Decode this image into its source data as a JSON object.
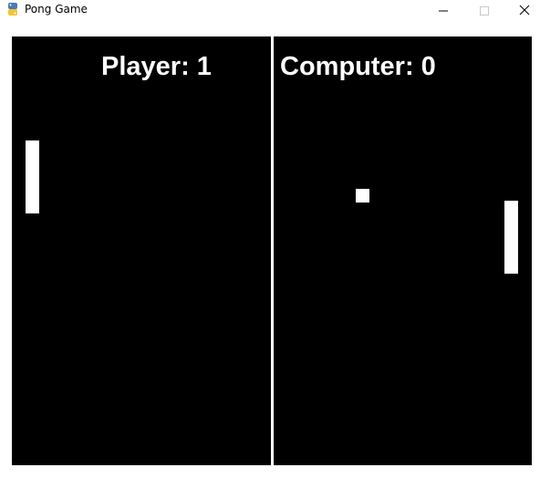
{
  "window": {
    "title": "Pong Game",
    "app_icon": "python-icon",
    "controls": {
      "minimize_icon": "minimize-icon",
      "maximize_icon": "maximize-icon",
      "close_icon": "close-icon"
    }
  },
  "game": {
    "background_color": "#000000",
    "foreground_color": "#ffffff",
    "scoreboard": {
      "player_label": "Player: 1",
      "computer_label": "Computer: 0"
    }
  }
}
